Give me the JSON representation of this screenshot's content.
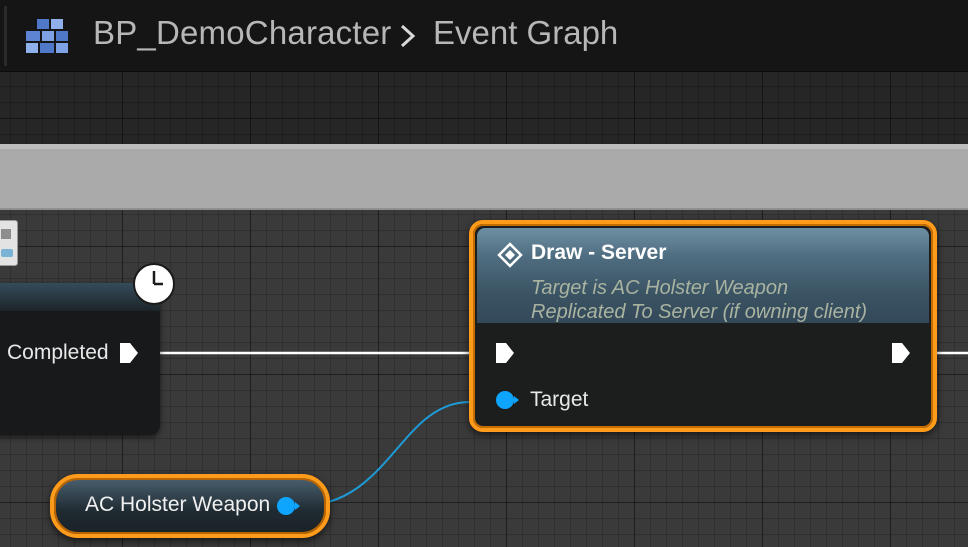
{
  "breadcrumb": {
    "root": "BP_DemoCharacter",
    "separator_icon": "chevron-right-icon",
    "current": "Event Graph",
    "blueprint_icon": "blueprint-icon"
  },
  "left_node": {
    "exec_out_label": "Completed",
    "latent_icon": "clock-icon"
  },
  "function_node": {
    "title": "Draw - Server",
    "subtitle_line1": "Target is AC Holster Weapon",
    "subtitle_line2": "Replicated To Server (if owning client)",
    "target_label": "Target",
    "icon": "function-diamond-icon"
  },
  "variable_node": {
    "label": "AC Holster Weapon"
  },
  "colors": {
    "selection_outline": "#ff9b1a",
    "object_pin": "#0ea5ff",
    "exec_wire": "#ffffff",
    "object_wire": "#1e9ad6",
    "grid_background": "#3a3a3a",
    "top_bar": "#151515"
  }
}
